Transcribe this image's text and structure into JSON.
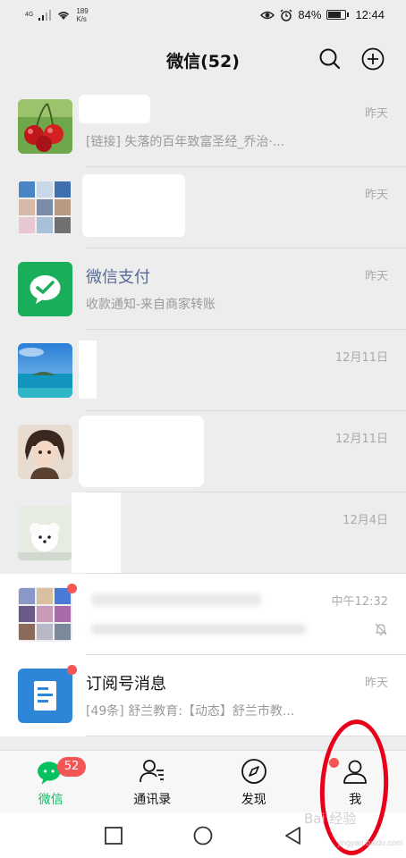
{
  "status_bar": {
    "network": "4G",
    "speed_value": "189",
    "speed_unit": "K/s",
    "battery": "84%",
    "battery_level": 0.84,
    "time": "12:44",
    "icons": [
      "signal-icon",
      "wifi-icon",
      "eye-icon",
      "alarm-icon",
      "battery-icon"
    ]
  },
  "header": {
    "title": "微信(52)",
    "icons": [
      "search-icon",
      "add-icon"
    ]
  },
  "chats": [
    {
      "name": "",
      "preview": "[链接] 失落的百年致富圣经_乔治·...",
      "time": "昨天"
    },
    {
      "name": "",
      "preview": "",
      "time": "昨天"
    },
    {
      "name": "微信支付",
      "preview": "收款通知-来自商家转账",
      "time": "昨天"
    },
    {
      "name": "",
      "preview": "",
      "time": "12月11日"
    },
    {
      "name": "",
      "preview": "",
      "time": "12月11日"
    },
    {
      "name": "",
      "preview": "",
      "time": "12月4日"
    },
    {
      "name": "",
      "preview": "",
      "time": "中午12:32",
      "muted": true
    },
    {
      "name": "订阅号消息",
      "preview": "[49条] 舒兰教育:【动态】舒兰市教...",
      "time": "昨天"
    }
  ],
  "tabs": [
    {
      "label": "微信",
      "badge": "52",
      "icon": "chat-icon",
      "active": true
    },
    {
      "label": "通讯录",
      "icon": "contacts-icon"
    },
    {
      "label": "发现",
      "icon": "compass-icon",
      "dot": true
    },
    {
      "label": "我",
      "icon": "person-icon"
    }
  ],
  "nav": {
    "icons": [
      "recent-apps-icon",
      "home-icon",
      "back-icon"
    ]
  },
  "colors": {
    "accent_green": "#07c160",
    "badge_red": "#f25755",
    "background": "#ededed",
    "annotation_red": "#e8001a"
  },
  "watermark": {
    "brand": "Bai 经验",
    "url": "jingyan.baidu.com"
  }
}
